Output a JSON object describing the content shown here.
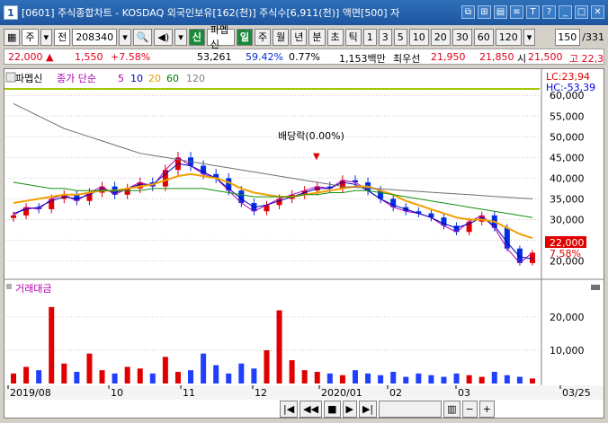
{
  "window": {
    "number": "1",
    "title": "[0601] 주식종합차트 - KOSDAQ 외국인보유[162(천)] 주식수[6,911(천)] 액면[500] 자",
    "controls": [
      "restore-icon",
      "link-icon",
      "pin-icon",
      "chart-icon",
      "text-icon",
      "help-icon",
      "min-icon",
      "max-icon",
      "close-icon"
    ]
  },
  "toolbar": {
    "market": "주",
    "prev": "전",
    "code": "208340",
    "signal": "신",
    "stock_name": "파멥신",
    "periods": [
      "일",
      "주",
      "월",
      "년",
      "분",
      "초",
      "틱"
    ],
    "intervals": [
      "1",
      "3",
      "5",
      "10",
      "20",
      "30",
      "60",
      "120"
    ],
    "page_count": "150",
    "page_total": "/331"
  },
  "info": {
    "price": "22,000",
    "change": "1,550",
    "change_pct": "+7.58%",
    "volume": "53,261",
    "vol_ratio": "59.42%",
    "turnover": "0.77%",
    "amount": "1,153백만",
    "best_label": "최우선",
    "ask": "21,950",
    "bid": "21,850",
    "open_label": "시",
    "open": "21,500",
    "high": "고 22,3"
  },
  "chart": {
    "stock_label": "파멥신",
    "legend": [
      "종가 단순",
      "5",
      "10",
      "20",
      "60",
      "120"
    ],
    "lc": "LC:23,94",
    "hc": "HC:-53,39",
    "dividend_annotation": "배당락(0.00%)",
    "current_price_tag": "22,000",
    "current_pct_tag": "7.58%",
    "volume_title": "거래대금",
    "x_labels": [
      "2019/08",
      "10",
      "11",
      "12",
      "2020/01",
      "02",
      "03",
      "03/25"
    ]
  },
  "chart_data": [
    {
      "type": "line",
      "title": "",
      "y_ticks": [
        60000,
        55000,
        50000,
        45000,
        40000,
        35000,
        30000,
        25000,
        20000
      ],
      "ylim": [
        16000,
        62000
      ],
      "series": [
        {
          "name": "종가",
          "values": [
            31000,
            33000,
            32500,
            35000,
            36000,
            34500,
            36500,
            38000,
            36000,
            37500,
            39000,
            38000,
            42000,
            45000,
            43000,
            41000,
            40000,
            37000,
            34000,
            32000,
            33500,
            35000,
            36000,
            37000,
            38000,
            37500,
            39500,
            39000,
            37000,
            35000,
            33000,
            32000,
            31500,
            30500,
            28500,
            27000,
            29500,
            31000,
            28000,
            23000,
            19500,
            22000
          ]
        },
        {
          "name": "5",
          "values": [
            31500,
            32500,
            33000,
            34500,
            35500,
            35000,
            36000,
            37500,
            36500,
            37500,
            38500,
            38500,
            41000,
            43500,
            43000,
            41500,
            40000,
            37500,
            35000,
            33000,
            33500,
            34500,
            35500,
            36500,
            37500,
            37500,
            39000,
            38500,
            37000,
            35000,
            33500,
            32500,
            31500,
            30500,
            29000,
            28000,
            29000,
            30500,
            28500,
            24500,
            21000,
            20500
          ]
        },
        {
          "name": "20",
          "values": [
            34000,
            34500,
            35000,
            35500,
            36000,
            36000,
            36500,
            37000,
            37000,
            37500,
            38000,
            38500,
            39500,
            40500,
            41000,
            40500,
            40000,
            39000,
            37500,
            36500,
            36000,
            35500,
            35500,
            36000,
            36500,
            37000,
            37500,
            38000,
            38000,
            37000,
            36000,
            34500,
            33500,
            32500,
            31500,
            30500,
            30000,
            30000,
            29500,
            28000,
            26500,
            25500
          ]
        },
        {
          "name": "60",
          "values": [
            39000,
            38500,
            38000,
            37500,
            37500,
            37000,
            37000,
            37000,
            37000,
            37000,
            37000,
            37500,
            37500,
            37500,
            37500,
            37500,
            37000,
            36500,
            36000,
            35500,
            35500,
            35500,
            35500,
            36000,
            36000,
            36500,
            36500,
            37000,
            37000,
            36500,
            36000,
            35500,
            35000,
            34500,
            34000,
            33500,
            33000,
            32500,
            32000,
            31500,
            31000,
            30500
          ]
        },
        {
          "name": "120",
          "values": [
            58000,
            56500,
            55000,
            53500,
            52000,
            51000,
            50000,
            49000,
            48000,
            47000,
            46000,
            45500,
            45000,
            44500,
            44000,
            43500,
            43000,
            42500,
            42000,
            41500,
            41000,
            40500,
            40000,
            39500,
            39000,
            38500,
            38000,
            37800,
            37600,
            37400,
            37200,
            37000,
            36800,
            36600,
            36400,
            36200,
            36000,
            35800,
            35600,
            35400,
            35200,
            35000
          ]
        }
      ]
    },
    {
      "type": "bar",
      "title": "",
      "y_ticks": [
        20000,
        10000
      ],
      "ylim": [
        0,
        27000
      ],
      "values": [
        3000,
        5000,
        4000,
        23000,
        6000,
        3500,
        9000,
        4000,
        3000,
        5000,
        4500,
        3000,
        8000,
        3500,
        4000,
        9000,
        5500,
        3000,
        6000,
        4500,
        10000,
        22000,
        7000,
        4000,
        3500,
        3000,
        2500,
        4000,
        3000,
        2500,
        3500,
        2000,
        3000,
        2500,
        2000,
        3000,
        2500,
        2000,
        3500,
        2500,
        2000,
        1500
      ]
    }
  ]
}
